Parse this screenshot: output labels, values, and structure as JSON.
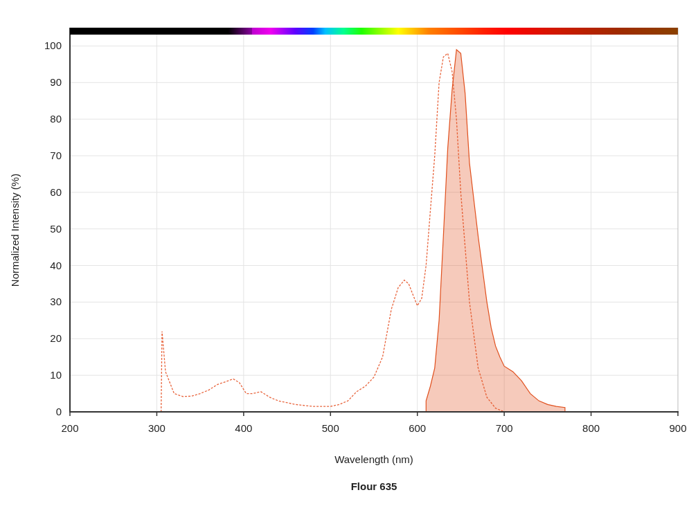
{
  "chart_data": {
    "type": "area",
    "title": "Flour 635",
    "xlabel": "Wavelength (nm)",
    "ylabel": "Normalized Intensity (%)",
    "xlim": [
      200,
      900
    ],
    "ylim": [
      0,
      105
    ],
    "xticks": [
      200,
      300,
      400,
      500,
      600,
      700,
      800,
      900
    ],
    "yticks": [
      0,
      10,
      20,
      30,
      40,
      50,
      60,
      70,
      80,
      90,
      100
    ],
    "grid": true,
    "series": [
      {
        "type": "line",
        "line_style": "dashed",
        "color": "#e8643c",
        "x": [
          305,
          306,
          310,
          320,
          330,
          340,
          350,
          360,
          370,
          380,
          388,
          395,
          403,
          410,
          420,
          430,
          440,
          460,
          480,
          500,
          510,
          520,
          530,
          540,
          550,
          560,
          570,
          578,
          585,
          590,
          595,
          600,
          605,
          610,
          615,
          620,
          625,
          630,
          635,
          640,
          645,
          650,
          655,
          660,
          670,
          680,
          690,
          700
        ],
        "values": [
          0,
          22,
          11,
          5,
          4.2,
          4.3,
          5,
          6,
          7.5,
          8.3,
          9,
          8,
          5,
          5,
          5.5,
          4,
          3,
          2,
          1.5,
          1.5,
          2,
          3,
          5.5,
          7,
          9.5,
          15,
          28,
          34,
          36,
          35,
          32,
          29,
          31,
          40,
          55,
          70,
          90,
          97,
          98,
          93,
          80,
          60,
          45,
          30,
          12,
          4,
          1,
          0
        ]
      },
      {
        "type": "area",
        "color": "#e0501e",
        "x": [
          610,
          610,
          615,
          620,
          625,
          630,
          635,
          640,
          645,
          650,
          655,
          660,
          670,
          680,
          685,
          690,
          695,
          700,
          710,
          720,
          730,
          740,
          750,
          760,
          770,
          770
        ],
        "values": [
          0,
          3,
          7,
          12,
          25,
          48,
          72,
          88,
          99,
          98,
          87,
          68,
          48,
          30,
          23,
          18,
          15,
          12.5,
          11,
          8.5,
          5,
          3,
          2,
          1.5,
          1.2,
          0
        ]
      }
    ]
  }
}
